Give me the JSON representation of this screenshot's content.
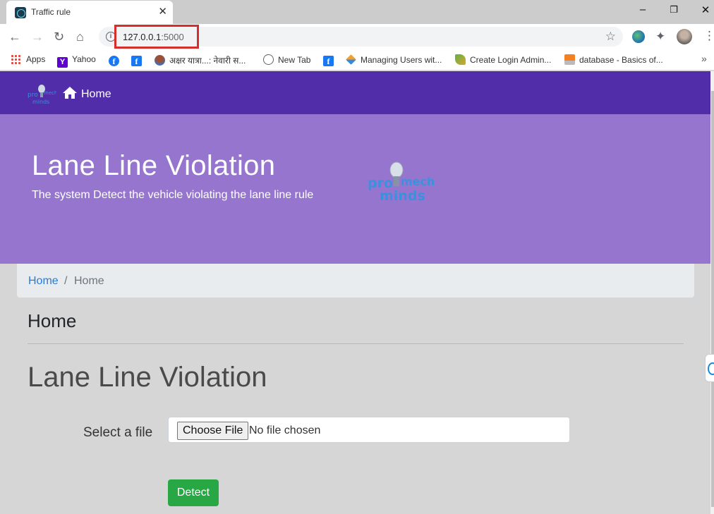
{
  "browser": {
    "tab_title": "Traffic rule",
    "url_host": "127.0.0.1",
    "url_port": ":5000",
    "bookmarks": [
      {
        "label": "Apps",
        "icon": "apps-grid-icon"
      },
      {
        "label": "Yahoo",
        "icon": "yahoo-icon"
      },
      {
        "label": "",
        "icon": "facebook-icon"
      },
      {
        "label": "",
        "icon": "facebook-square-icon"
      },
      {
        "label": "अक्षर यात्रा...: नेवारी स...",
        "icon": "person-icon"
      },
      {
        "label": "New Tab",
        "icon": "globe-icon"
      },
      {
        "label": "",
        "icon": "facebook-square-icon"
      },
      {
        "label": "Managing Users wit...",
        "icon": "diamond-icon"
      },
      {
        "label": "Create Login Admin...",
        "icon": "leaf-icon"
      },
      {
        "label": "database - Basics of...",
        "icon": "stackoverflow-icon"
      }
    ],
    "bookmarks_more": "»"
  },
  "navbar": {
    "brand_logo": "promech minds",
    "home_label": "Home"
  },
  "jumbotron": {
    "title": "Lane Line Violation",
    "subtitle": "The system Detect the vehicle violating the lane line rule"
  },
  "breadcrumb": {
    "link": "Home",
    "separator": "/",
    "current": "Home"
  },
  "section_title": "Home",
  "form": {
    "title": "Lane Line Violation",
    "file_label": "Select a file",
    "choose_button": "Choose File",
    "file_status": "No file chosen",
    "submit_label": "Detect"
  },
  "colors": {
    "navbar": "#512daa",
    "jumbotron": "#9675cf",
    "detect_button": "#28a745",
    "url_highlight": "#d62d2d"
  }
}
